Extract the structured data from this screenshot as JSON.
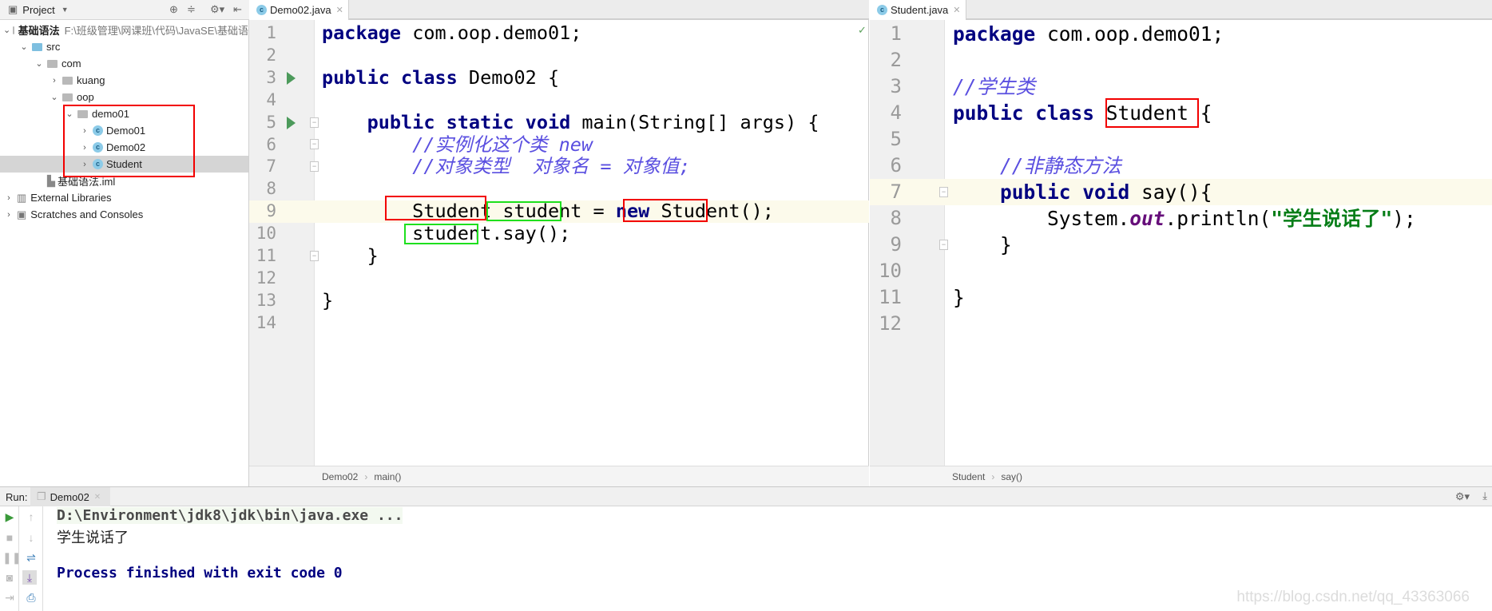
{
  "sidebar": {
    "title": "Project",
    "tree": [
      {
        "label": "基础语法",
        "path": "F:\\班级管理\\网课班\\代码\\JavaSE\\基础语",
        "level": 0,
        "expanded": true,
        "icon": "module-folder-icon",
        "bold": true
      },
      {
        "label": "src",
        "level": 1,
        "expanded": true,
        "icon": "source-folder-icon"
      },
      {
        "label": "com",
        "level": 2,
        "expanded": true,
        "icon": "package-icon"
      },
      {
        "label": "kuang",
        "level": 3,
        "expanded": false,
        "icon": "package-icon"
      },
      {
        "label": "oop",
        "level": 3,
        "expanded": true,
        "icon": "package-icon"
      },
      {
        "label": "demo01",
        "level": 4,
        "expanded": true,
        "icon": "package-icon"
      },
      {
        "label": "Demo01",
        "level": 5,
        "expanded": false,
        "icon": "class-icon"
      },
      {
        "label": "Demo02",
        "level": 5,
        "expanded": false,
        "icon": "class-icon"
      },
      {
        "label": "Student",
        "level": 5,
        "expanded": false,
        "icon": "class-icon",
        "selected": true
      },
      {
        "label": "基础语法.iml",
        "level": 2,
        "icon": "iml-file-icon"
      },
      {
        "label": "External Libraries",
        "level": 0,
        "expanded": false,
        "icon": "libraries-icon"
      },
      {
        "label": "Scratches and Consoles",
        "level": 0,
        "expanded": false,
        "icon": "scratches-icon"
      }
    ]
  },
  "left_editor": {
    "tab": "Demo02.java",
    "breadcrumb": [
      "Demo02",
      "main()"
    ],
    "current_line": 9,
    "run_lines": [
      3,
      5
    ],
    "lines": [
      [
        [
          "kw",
          "package"
        ],
        [
          "p",
          " com.oop.demo01;"
        ]
      ],
      [],
      [
        [
          "kw",
          "public class"
        ],
        [
          "p",
          " Demo02 {"
        ]
      ],
      [],
      [
        [
          "p",
          "    "
        ],
        [
          "kw",
          "public static void"
        ],
        [
          "p",
          " main(String[] args) {"
        ]
      ],
      [
        [
          "p",
          "        "
        ],
        [
          "cm",
          "//实例化这个类 new"
        ]
      ],
      [
        [
          "p",
          "        "
        ],
        [
          "cm",
          "//对象类型  对象名 = 对象值;"
        ]
      ],
      [],
      [
        [
          "p",
          "        Student student = "
        ],
        [
          "kw",
          "new"
        ],
        [
          "p",
          " Student();"
        ]
      ],
      [
        [
          "p",
          "        student.say();"
        ]
      ],
      [
        [
          "p",
          "    }"
        ]
      ],
      [],
      [
        [
          "p",
          "}"
        ]
      ],
      []
    ]
  },
  "right_editor": {
    "tab": "Student.java",
    "breadcrumb": [
      "Student",
      "say()"
    ],
    "current_line": 7,
    "lines": [
      [
        [
          "kw",
          "package"
        ],
        [
          "p",
          " com.oop.demo01;"
        ]
      ],
      [],
      [
        [
          "cm",
          "//学生类"
        ]
      ],
      [
        [
          "kw",
          "public class"
        ],
        [
          "p",
          " Student {"
        ]
      ],
      [],
      [
        [
          "p",
          "    "
        ],
        [
          "cm",
          "//非静态方法"
        ]
      ],
      [
        [
          "p",
          "    "
        ],
        [
          "kw",
          "public void"
        ],
        [
          "p",
          " say(){"
        ]
      ],
      [
        [
          "p",
          "        System."
        ],
        [
          "fld",
          "out"
        ],
        [
          "p",
          ".println("
        ],
        [
          "str",
          "\"学生说话了\""
        ],
        [
          "p",
          ");"
        ]
      ],
      [
        [
          "p",
          "    }"
        ]
      ],
      [],
      [
        [
          "p",
          "}"
        ]
      ],
      []
    ]
  },
  "run": {
    "label": "Run:",
    "tab": "Demo02",
    "console": [
      {
        "text": "D:\\Environment\\jdk8\\jdk\\bin\\java.exe ...",
        "color": "#4a4a4a"
      },
      {
        "text": "学生说话了",
        "color": "#222222"
      },
      {
        "text": "",
        "color": "#000000"
      },
      {
        "text": "Process finished with exit code 0",
        "color": "#000080"
      }
    ]
  },
  "watermark": "https://blog.csdn.net/qq_43363066"
}
